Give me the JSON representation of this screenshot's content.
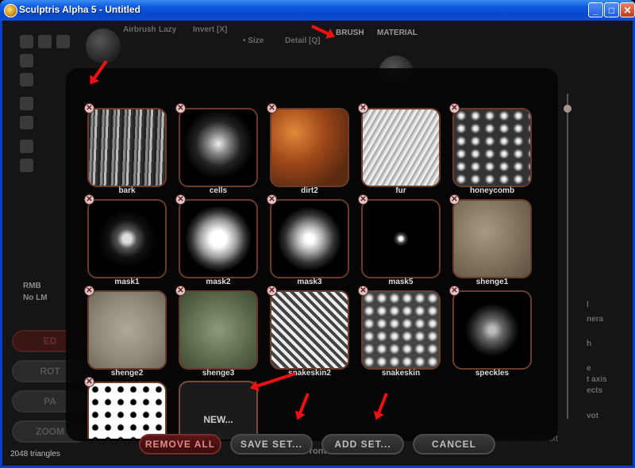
{
  "window": {
    "title": "Sculptris Alpha 5 - Untitled",
    "minimize_label": "_",
    "maximize_label": "□",
    "close_label": "✕"
  },
  "background": {
    "airbrush_label": "Airbrush",
    "lazy_label": "Lazy",
    "invert_label": "Invert [X]",
    "size_label": "• Size",
    "detail_label": "Detail [Q]",
    "brush_label": "BRUSH",
    "material_label": "MATERIAL",
    "rmb_label": "RMB",
    "nolmb_label": "No LM",
    "side_buttons": [
      "ED",
      "ROT",
      "PA",
      "ZOOM"
    ],
    "triangles": "2048 triangles",
    "view_label": "Front",
    "readmore_label": "Read more in documentation.txt",
    "right_labels": [
      "l",
      "nera",
      "h",
      "e",
      "t axis",
      "ects",
      "vot"
    ]
  },
  "brush_set": {
    "items": [
      {
        "name": "bark",
        "texture": "bark"
      },
      {
        "name": "cells",
        "texture": "cells"
      },
      {
        "name": "dirt2",
        "texture": "dirt"
      },
      {
        "name": "fur",
        "texture": "fur"
      },
      {
        "name": "honeycomb",
        "texture": "honeycomb"
      },
      {
        "name": "mask1",
        "texture": "mask1"
      },
      {
        "name": "mask2",
        "texture": "mask2"
      },
      {
        "name": "mask3",
        "texture": "mask3"
      },
      {
        "name": "mask5",
        "texture": "mask5"
      },
      {
        "name": "shenge1",
        "texture": "rock"
      },
      {
        "name": "shenge2",
        "texture": "rock2"
      },
      {
        "name": "shenge3",
        "texture": "moss"
      },
      {
        "name": "snakeskin2",
        "texture": "snake2"
      },
      {
        "name": "snakeskin",
        "texture": "snake"
      },
      {
        "name": "speckles",
        "texture": "speckles"
      },
      {
        "name": "",
        "texture": "dots"
      }
    ],
    "new_label": "NEW...",
    "delete_icon": "✕",
    "buttons": {
      "remove_all": "REMOVE ALL",
      "save_set": "SAVE SET...",
      "add_set": "ADD SET...",
      "cancel": "CANCEL"
    }
  },
  "annotation_color": "#ee1111"
}
